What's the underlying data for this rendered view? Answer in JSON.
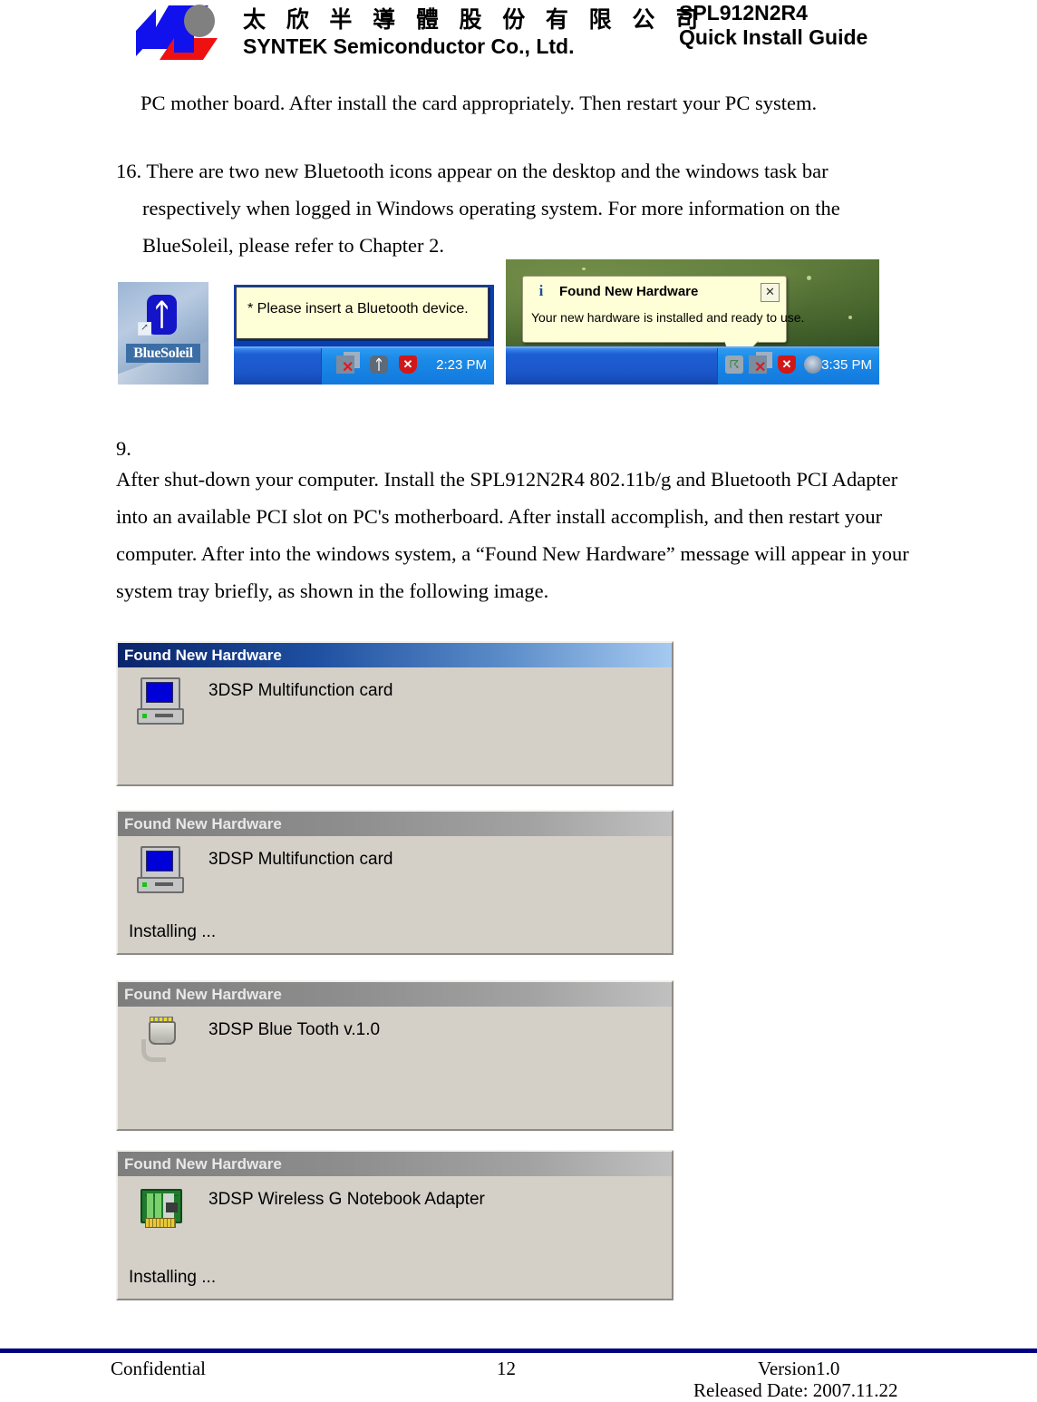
{
  "header": {
    "company_cn": "太 欣 半 導 體 股 份 有 限 公 司",
    "company_en": "SYNTEK Semiconductor Co., Ltd.",
    "model": "SPL912N2R4",
    "doc_title": "Quick Install Guide",
    "logo_icon": "syntek-logo-icon"
  },
  "body": {
    "intro_paragraph": "PC mother board. After install the card appropriately. Then restart your PC system.",
    "step16": "16. There are two new Bluetooth icons appear on the desktop and the windows task bar respectively when logged in Windows operating system. For more information on the BlueSoleil, please refer to Chapter 2.",
    "step9_number": "9.",
    "step9": "After shut-down your computer. Install the SPL912N2R4 802.11b/g and Bluetooth PCI Adapter into an available PCI slot on PC's motherboard. After install accomplish, and then restart your computer. After into the windows system, a “Found New Hardware” message will appear in your system tray briefly, as shown in the following image."
  },
  "figure_icons": {
    "desktop_icon": {
      "label": "BlueSoleil",
      "glyph_icon": "bluetooth-icon",
      "shortcut_icon": "shortcut-arrow-icon"
    },
    "taskbar_left": {
      "tooltip": "* Please insert a Bluetooth device.",
      "clock": "2:23 PM",
      "tray_icons": [
        "network-disconnected-icon",
        "bluetooth-icon",
        "security-alert-shield-icon"
      ]
    },
    "desktop_right": {
      "balloon_title": "Found New Hardware",
      "balloon_body": "Your new hardware is installed and ready to use.",
      "info_glyph": "i",
      "close_glyph": "✕",
      "clock": "3:35 PM",
      "tray_icons": [
        "plug-icon",
        "network-disconnected-icon",
        "security-alert-shield-icon",
        "volume-icon"
      ]
    }
  },
  "dialogs": [
    {
      "title": "Found New Hardware",
      "device": "3DSP Multifunction card",
      "status": "",
      "state": "active",
      "icon": "computer-icon"
    },
    {
      "title": "Found New Hardware",
      "device": "3DSP Multifunction card",
      "status": "Installing ...",
      "state": "inactive",
      "icon": "computer-icon"
    },
    {
      "title": "Found New Hardware",
      "device": "3DSP Blue Tooth v.1.0",
      "status": "",
      "state": "inactive",
      "icon": "bluetooth-dongle-icon"
    },
    {
      "title": "Found New Hardware",
      "device": "3DSP Wireless G Notebook Adapter",
      "status": "Installing ...",
      "state": "inactive",
      "icon": "pci-card-icon"
    }
  ],
  "footer": {
    "confidential": "Confidential",
    "page_number": "12",
    "version": "Version1.0",
    "released_date": "Released Date: 2007.11.22",
    "rule_color": "#000080"
  }
}
